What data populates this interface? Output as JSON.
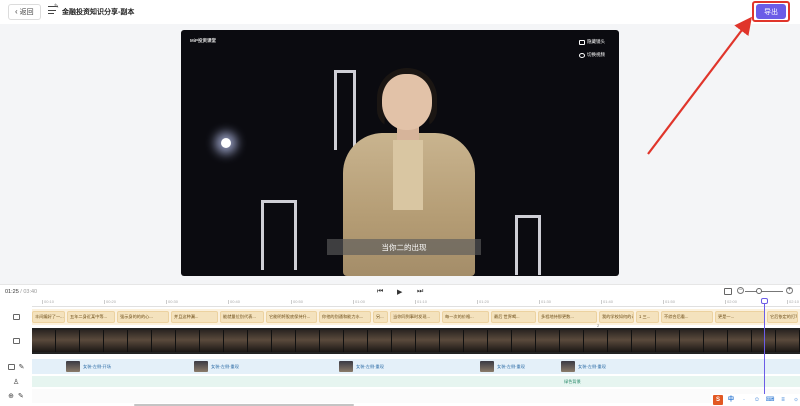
{
  "header": {
    "back_label": "返回",
    "title": "金融投资知识分享-副本",
    "export_label": "导出"
  },
  "canvas": {
    "brand": "MiP投资课堂",
    "chips": [
      "隐藏镜头",
      "切换视频"
    ],
    "subtitle": "当你二的出现"
  },
  "player": {
    "current_time": "01:25",
    "total_time": "/ 03:40"
  },
  "ruler_ticks": [
    "00:10",
    "00:20",
    "00:30",
    "00:40",
    "00:50",
    "01:00",
    "01:10",
    "01:20",
    "01:30",
    "01:40",
    "01:50",
    "02:00",
    "02:10",
    "02:20"
  ],
  "text_segments": [
    "丰间编好了一...",
    "五年二身近某中等...",
    "强示身的的的心...",
    "并且这种漏...",
    "能就量位别代表...",
    "它能明将股底保持升...",
    "你他的别通和能力水...",
    "另...",
    "当你同到事时发现...",
    "每一次的价格...",
    "最后 世界喝...",
    "多程地持那更数...",
    "我的学校如何的认...",
    "1 三...",
    "不综合后看...",
    "更是一...",
    "它后依定的打写...",
    "那是将网证定般...",
    "溶设完..."
  ],
  "avatar_segments": [
    "女装-左侧-开场",
    "女装-左侧-重现",
    "女装-左侧-重现",
    "女装-左侧-重现",
    "女装-左侧-重现"
  ],
  "bg_segment": "绿色背景",
  "ime": {
    "logo": "S",
    "lang": "中",
    "items": [
      "·",
      "☺",
      "⌨",
      "≡",
      "☼",
      "▦"
    ]
  },
  "colors": {
    "accent": "#6b5ce7",
    "highlight": "#e0352b",
    "text_track": "#f4e2bd",
    "avatar_track": "#e4f0f9",
    "bg_track": "#e6f5f0"
  }
}
